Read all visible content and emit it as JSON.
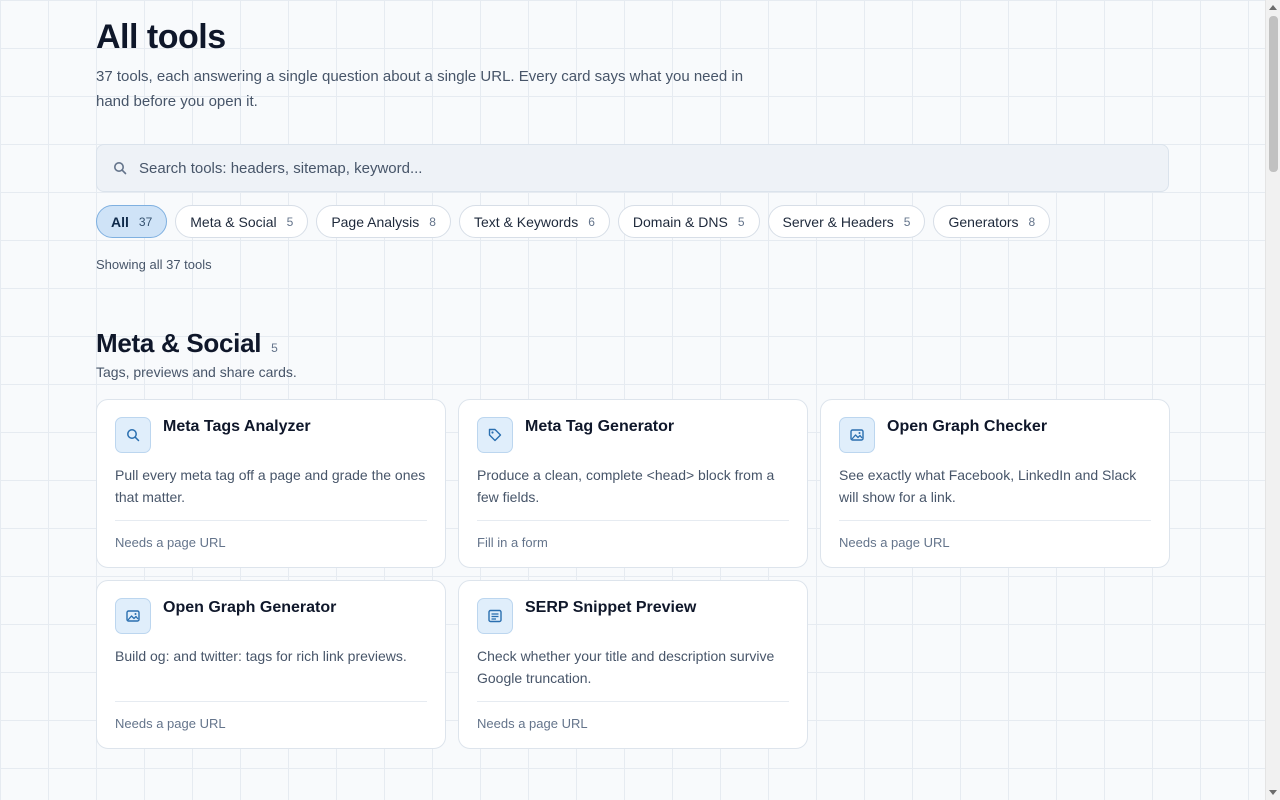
{
  "header": {
    "title": "All tools",
    "subtitle": "37 tools, each answering a single question about a single URL. Every card says what you need in hand before you open it."
  },
  "search": {
    "placeholder": "Search tools: headers, sitemap, keyword...",
    "value": "",
    "icon": "search-icon"
  },
  "filters": [
    {
      "label": "All",
      "count": "37",
      "active": true
    },
    {
      "label": "Meta & Social",
      "count": "5",
      "active": false
    },
    {
      "label": "Page Analysis",
      "count": "8",
      "active": false
    },
    {
      "label": "Text & Keywords",
      "count": "6",
      "active": false
    },
    {
      "label": "Domain & DNS",
      "count": "5",
      "active": false
    },
    {
      "label": "Server & Headers",
      "count": "5",
      "active": false
    },
    {
      "label": "Generators",
      "count": "8",
      "active": false
    }
  ],
  "status": "Showing all 37 tools",
  "section": {
    "title": "Meta & Social",
    "count": "5",
    "description": "Tags, previews and share cards.",
    "cards": [
      {
        "icon": "search-icon",
        "title": "Meta Tags Analyzer",
        "description": "Pull every meta tag off a page and grade the ones that matter.",
        "requirement": "Needs a page URL"
      },
      {
        "icon": "tag-icon",
        "title": "Meta Tag Generator",
        "description": "Produce a clean, complete <head> block from a few fields.",
        "requirement": "Fill in a form"
      },
      {
        "icon": "image-icon",
        "title": "Open Graph Checker",
        "description": "See exactly what Facebook, LinkedIn and Slack will show for a link.",
        "requirement": "Needs a page URL"
      },
      {
        "icon": "image-edit-icon",
        "title": "Open Graph Generator",
        "description": "Build og: and twitter: tags for rich link previews.",
        "requirement": "Needs a page URL"
      },
      {
        "icon": "snippet-icon",
        "title": "SERP Snippet Preview",
        "description": "Check whether your title and description survive Google truncation.",
        "requirement": "Needs a page URL"
      }
    ]
  },
  "colors": {
    "accent": "#2a6fb0",
    "chip_active_bg": "#cfe3f7",
    "icon_bg": "#e0eefb"
  }
}
